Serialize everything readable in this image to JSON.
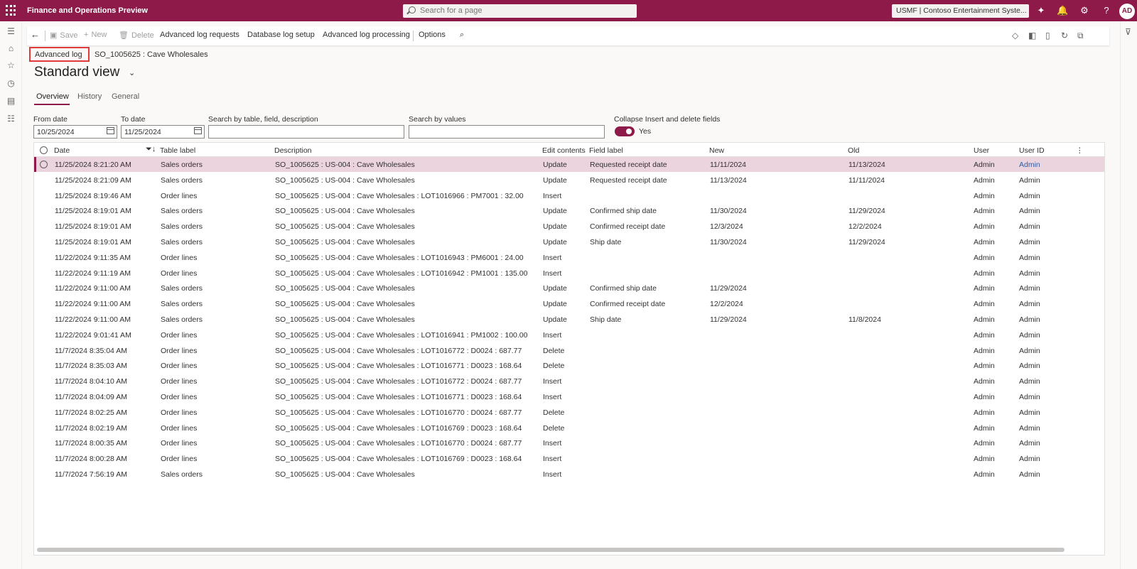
{
  "app": {
    "title": "Finance and Operations Preview",
    "search_placeholder": "Search for a page",
    "company": "USMF | Contoso Entertainment Syste...",
    "user_initials": "AD"
  },
  "actions": {
    "save": "Save",
    "new": "New",
    "delete": "Delete",
    "advanced_log_requests": "Advanced log requests",
    "database_log_setup": "Database log setup",
    "advanced_log_processing": "Advanced log processing",
    "options": "Options"
  },
  "breadcrumb": {
    "page": "Advanced log",
    "record": "SO_1005625 : Cave Wholesales"
  },
  "view": {
    "title": "Standard view"
  },
  "tabs": [
    "Overview",
    "History",
    "General"
  ],
  "filters": {
    "from_date_label": "From date",
    "from_date": "10/25/2024",
    "to_date_label": "To date",
    "to_date": "11/25/2024",
    "search_table_label": "Search by table, field, description",
    "search_values_label": "Search by values",
    "collapse_label": "Collapse Insert and delete fields",
    "collapse_value": "Yes"
  },
  "grid": {
    "columns": [
      "Date",
      "Table label",
      "Description",
      "Edit contents",
      "Field label",
      "New",
      "Old",
      "User",
      "User ID"
    ],
    "rows": [
      [
        "11/25/2024 8:21:20 AM",
        "Sales orders",
        "SO_1005625 : US-004 : Cave Wholesales",
        "Update",
        "Requested receipt date",
        "11/11/2024",
        "11/13/2024",
        "Admin",
        "Admin"
      ],
      [
        "11/25/2024 8:21:09 AM",
        "Sales orders",
        "SO_1005625 : US-004 : Cave Wholesales",
        "Update",
        "Requested receipt date",
        "11/13/2024",
        "11/11/2024",
        "Admin",
        "Admin"
      ],
      [
        "11/25/2024 8:19:46 AM",
        "Order lines",
        "SO_1005625 : US-004 : Cave Wholesales : LOT1016966 : PM7001 : 32.00",
        "Insert",
        "",
        "",
        "",
        "Admin",
        "Admin"
      ],
      [
        "11/25/2024 8:19:01 AM",
        "Sales orders",
        "SO_1005625 : US-004 : Cave Wholesales",
        "Update",
        "Confirmed ship date",
        "11/30/2024",
        "11/29/2024",
        "Admin",
        "Admin"
      ],
      [
        "11/25/2024 8:19:01 AM",
        "Sales orders",
        "SO_1005625 : US-004 : Cave Wholesales",
        "Update",
        "Confirmed receipt date",
        "12/3/2024",
        "12/2/2024",
        "Admin",
        "Admin"
      ],
      [
        "11/25/2024 8:19:01 AM",
        "Sales orders",
        "SO_1005625 : US-004 : Cave Wholesales",
        "Update",
        "Ship date",
        "11/30/2024",
        "11/29/2024",
        "Admin",
        "Admin"
      ],
      [
        "11/22/2024 9:11:35 AM",
        "Order lines",
        "SO_1005625 : US-004 : Cave Wholesales : LOT1016943 : PM6001 : 24.00",
        "Insert",
        "",
        "",
        "",
        "Admin",
        "Admin"
      ],
      [
        "11/22/2024 9:11:19 AM",
        "Order lines",
        "SO_1005625 : US-004 : Cave Wholesales : LOT1016942 : PM1001 : 135.00",
        "Insert",
        "",
        "",
        "",
        "Admin",
        "Admin"
      ],
      [
        "11/22/2024 9:11:00 AM",
        "Sales orders",
        "SO_1005625 : US-004 : Cave Wholesales",
        "Update",
        "Confirmed ship date",
        "11/29/2024",
        "",
        "Admin",
        "Admin"
      ],
      [
        "11/22/2024 9:11:00 AM",
        "Sales orders",
        "SO_1005625 : US-004 : Cave Wholesales",
        "Update",
        "Confirmed receipt date",
        "12/2/2024",
        "",
        "Admin",
        "Admin"
      ],
      [
        "11/22/2024 9:11:00 AM",
        "Sales orders",
        "SO_1005625 : US-004 : Cave Wholesales",
        "Update",
        "Ship date",
        "11/29/2024",
        "11/8/2024",
        "Admin",
        "Admin"
      ],
      [
        "11/22/2024 9:01:41 AM",
        "Order lines",
        "SO_1005625 : US-004 : Cave Wholesales : LOT1016941 : PM1002 : 100.00",
        "Insert",
        "",
        "",
        "",
        "Admin",
        "Admin"
      ],
      [
        "11/7/2024 8:35:04 AM",
        "Order lines",
        "SO_1005625 : US-004 : Cave Wholesales : LOT1016772 : D0024 : 687.77",
        "Delete",
        "",
        "",
        "",
        "Admin",
        "Admin"
      ],
      [
        "11/7/2024 8:35:03 AM",
        "Order lines",
        "SO_1005625 : US-004 : Cave Wholesales : LOT1016771 : D0023 : 168.64",
        "Delete",
        "",
        "",
        "",
        "Admin",
        "Admin"
      ],
      [
        "11/7/2024 8:04:10 AM",
        "Order lines",
        "SO_1005625 : US-004 : Cave Wholesales : LOT1016772 : D0024 : 687.77",
        "Insert",
        "",
        "",
        "",
        "Admin",
        "Admin"
      ],
      [
        "11/7/2024 8:04:09 AM",
        "Order lines",
        "SO_1005625 : US-004 : Cave Wholesales : LOT1016771 : D0023 : 168.64",
        "Insert",
        "",
        "",
        "",
        "Admin",
        "Admin"
      ],
      [
        "11/7/2024 8:02:25 AM",
        "Order lines",
        "SO_1005625 : US-004 : Cave Wholesales : LOT1016770 : D0024 : 687.77",
        "Delete",
        "",
        "",
        "",
        "Admin",
        "Admin"
      ],
      [
        "11/7/2024 8:02:19 AM",
        "Order lines",
        "SO_1005625 : US-004 : Cave Wholesales : LOT1016769 : D0023 : 168.64",
        "Delete",
        "",
        "",
        "",
        "Admin",
        "Admin"
      ],
      [
        "11/7/2024 8:00:35 AM",
        "Order lines",
        "SO_1005625 : US-004 : Cave Wholesales : LOT1016770 : D0024 : 687.77",
        "Insert",
        "",
        "",
        "",
        "Admin",
        "Admin"
      ],
      [
        "11/7/2024 8:00:28 AM",
        "Order lines",
        "SO_1005625 : US-004 : Cave Wholesales : LOT1016769 : D0023 : 168.64",
        "Insert",
        "",
        "",
        "",
        "Admin",
        "Admin"
      ],
      [
        "11/7/2024 7:56:19 AM",
        "Sales orders",
        "SO_1005625 : US-004 : Cave Wholesales",
        "Insert",
        "",
        "",
        "",
        "Admin",
        "Admin"
      ]
    ]
  },
  "colors": {
    "brand": "#8e1a49",
    "selected_row": "#ecd4de",
    "link": "#2e5ba8"
  }
}
